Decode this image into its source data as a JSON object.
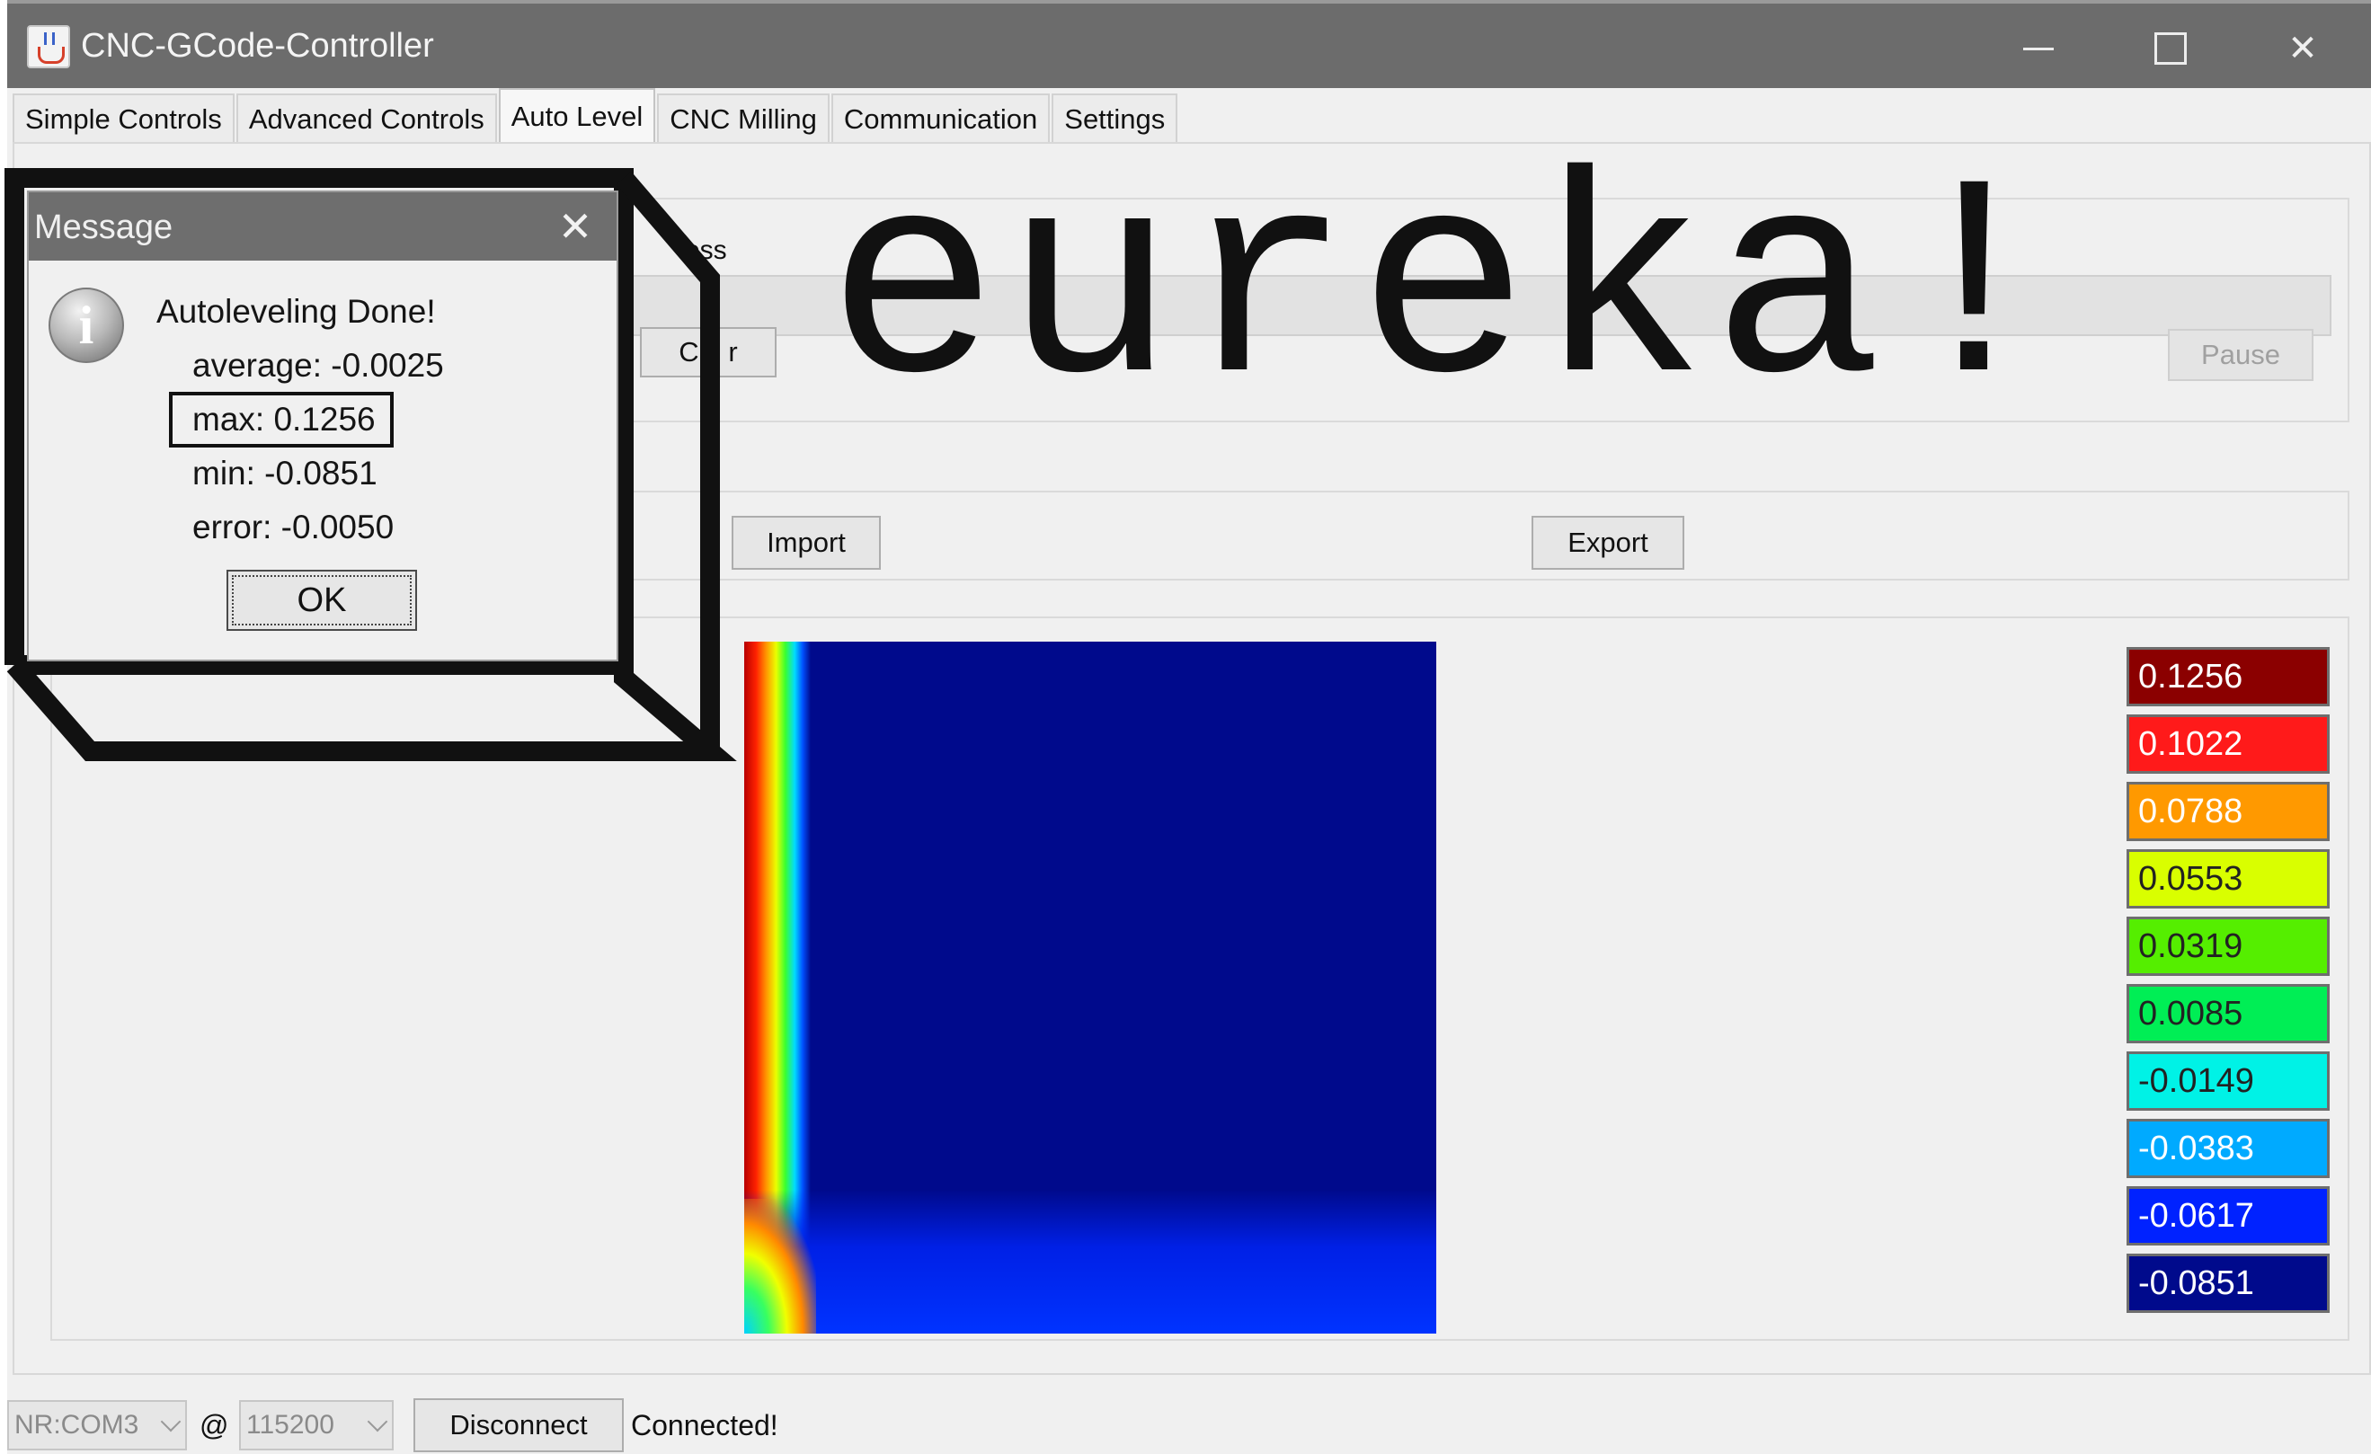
{
  "window": {
    "title": "CNC-GCode-Controller",
    "close_glyph": "✕"
  },
  "tabs": [
    {
      "label": "Simple Controls"
    },
    {
      "label": "Advanced Controls"
    },
    {
      "label": "Auto Level",
      "active": true
    },
    {
      "label": "CNC Milling"
    },
    {
      "label": "Communication"
    },
    {
      "label": "Settings"
    }
  ],
  "progress": {
    "legend_visible": "ess",
    "clear_label": "Cle r",
    "pause_label": "Pause"
  },
  "file_buttons": {
    "import_label": "Import",
    "export_label": "Export"
  },
  "legend": {
    "items": [
      {
        "value": "0.1256",
        "color": "#8b0000",
        "text_color": "#ffffff"
      },
      {
        "value": "0.1022",
        "color": "#ff1a1a",
        "text_color": "#ffffff"
      },
      {
        "value": "0.0788",
        "color": "#ff9900",
        "text_color": "#ffffff"
      },
      {
        "value": "0.0553",
        "color": "#d9ff00",
        "text_color": "#222222"
      },
      {
        "value": "0.0319",
        "color": "#55ee00",
        "text_color": "#222222"
      },
      {
        "value": "0.0085",
        "color": "#00ee55",
        "text_color": "#222222"
      },
      {
        "value": "-0.0149",
        "color": "#00f2e6",
        "text_color": "#222222"
      },
      {
        "value": "-0.0383",
        "color": "#00aaff",
        "text_color": "#ffffff"
      },
      {
        "value": "-0.0617",
        "color": "#0022ff",
        "text_color": "#ffffff"
      },
      {
        "value": "-0.0851",
        "color": "#000a8c",
        "text_color": "#ffffff"
      }
    ]
  },
  "statusbar": {
    "port": "NR:COM3",
    "at": "@",
    "baud": "115200",
    "disconnect_label": "Disconnect",
    "status": "Connected!"
  },
  "dialog": {
    "title": "Message",
    "close_glyph": "✕",
    "headline": "Autoleveling Done!",
    "average": "average: -0.0025",
    "max": "max: 0.1256",
    "min": "min: -0.0851",
    "error": "error: -0.0050",
    "ok_label": "OK",
    "icon_glyph": "i"
  },
  "overlay": {
    "text": "eureka!"
  },
  "colors": {
    "titlebar": "#6c6c6c",
    "background": "#f0f0f0",
    "heatmap_base": "#000a8c"
  }
}
